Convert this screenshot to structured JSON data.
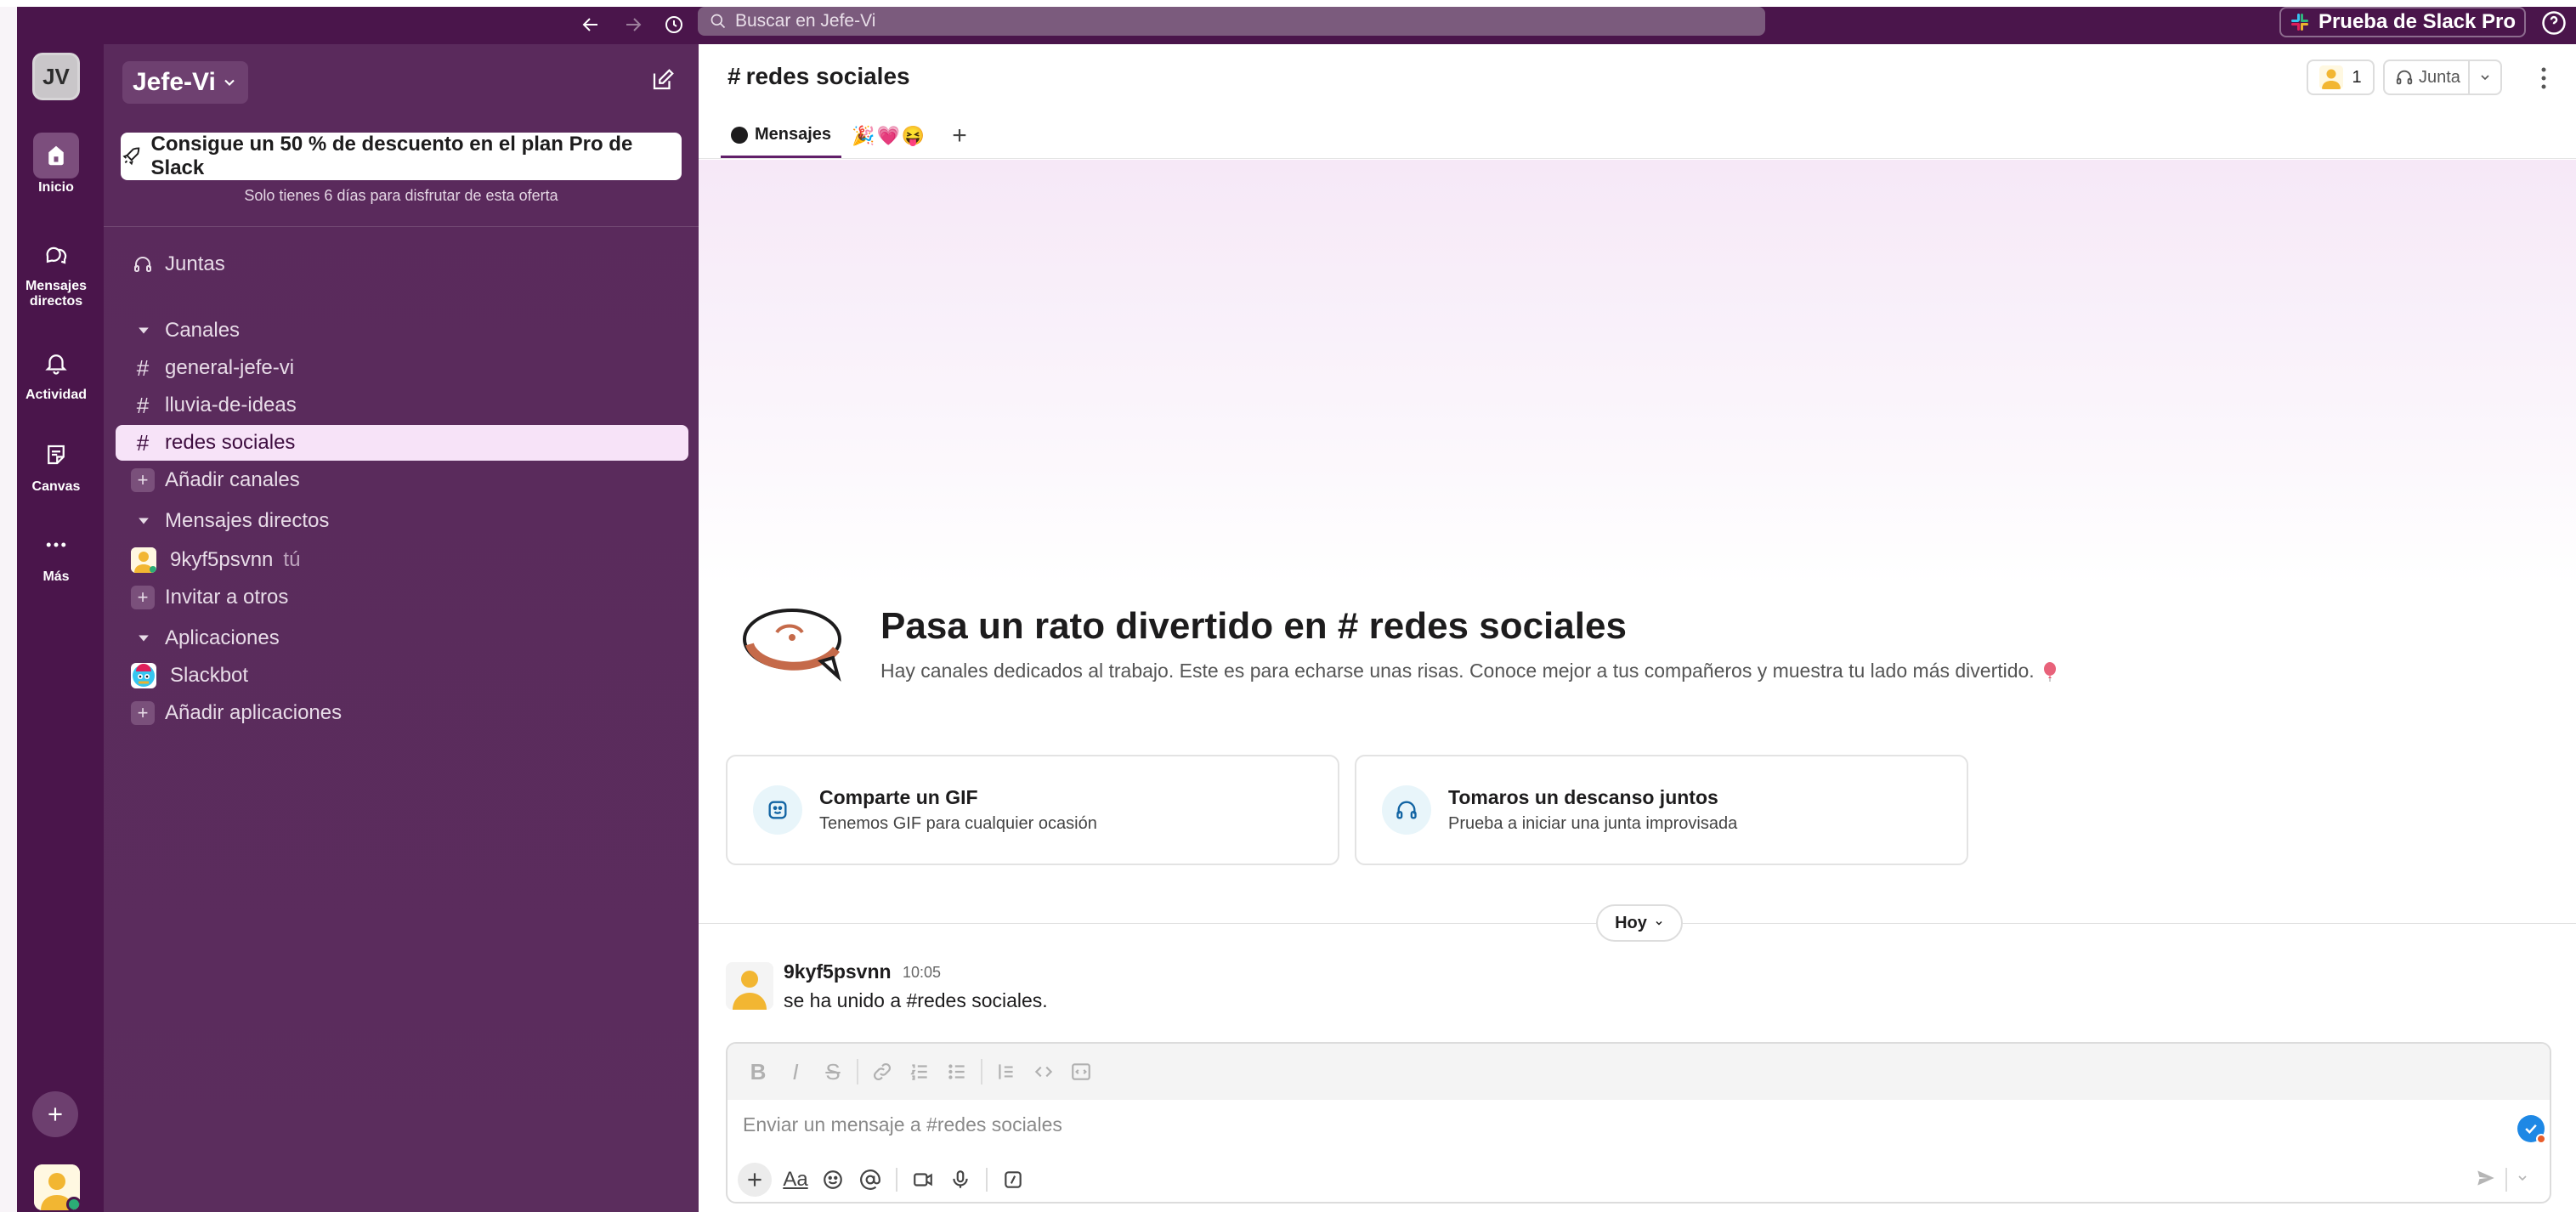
{
  "topbar": {
    "search_placeholder": "Buscar en Jefe-Vi",
    "trial_button": "Prueba de Slack Pro"
  },
  "rail": {
    "workspace_initials": "JV",
    "items": [
      {
        "label": "Inicio",
        "icon": "home-icon"
      },
      {
        "label": "Mensajes directos",
        "icon": "dm-icon"
      },
      {
        "label": "Actividad",
        "icon": "bell-icon"
      },
      {
        "label": "Canvas",
        "icon": "canvas-icon"
      },
      {
        "label": "Más",
        "icon": "more-icon"
      }
    ]
  },
  "sidebar": {
    "workspace_name": "Jefe-Vi",
    "promo_button": "Consigue un 50 % de descuento en el plan Pro de Slack",
    "promo_subtitle": "Solo tienes 6 días para disfrutar de esta oferta",
    "huddles_label": "Juntas",
    "channels_header": "Canales",
    "channels": [
      "general-jefe-vi",
      "lluvia-de-ideas",
      "redes sociales"
    ],
    "add_channels": "Añadir canales",
    "dms_header": "Mensajes directos",
    "dm_user": "9kyf5psvnn",
    "dm_you": "tú",
    "invite": "Invitar a otros",
    "apps_header": "Aplicaciones",
    "app_slackbot": "Slackbot",
    "add_apps": "Añadir aplicaciones"
  },
  "channel": {
    "hash": "#",
    "name": "redes sociales",
    "member_count": "1",
    "huddle_label": "Junta",
    "tabs": {
      "messages": "Mensajes",
      "emoji_tab": "🎉💗😝"
    }
  },
  "intro": {
    "title": "Pasa un rato divertido en # redes sociales",
    "description": "Hay canales dedicados al trabajo. Este es para echarse unas risas. Conoce mejor a tus compañeros y muestra tu lado más divertido."
  },
  "cards": [
    {
      "title": "Comparte un GIF",
      "subtitle": "Tenemos GIF para cualquier ocasión"
    },
    {
      "title": "Tomaros un descanso juntos",
      "subtitle": "Prueba a iniciar una junta improvisada"
    }
  ],
  "day_divider": "Hoy",
  "message": {
    "author": "9kyf5psvnn",
    "time": "10:05",
    "text": "se ha unido a #redes sociales."
  },
  "composer": {
    "placeholder": "Enviar un mensaje a #redes sociales",
    "aa_label": "Aa"
  },
  "colors": {
    "aubergine": "#4a154b",
    "sidebar": "#5a2a5c",
    "active_row": "#f7e3f8"
  }
}
